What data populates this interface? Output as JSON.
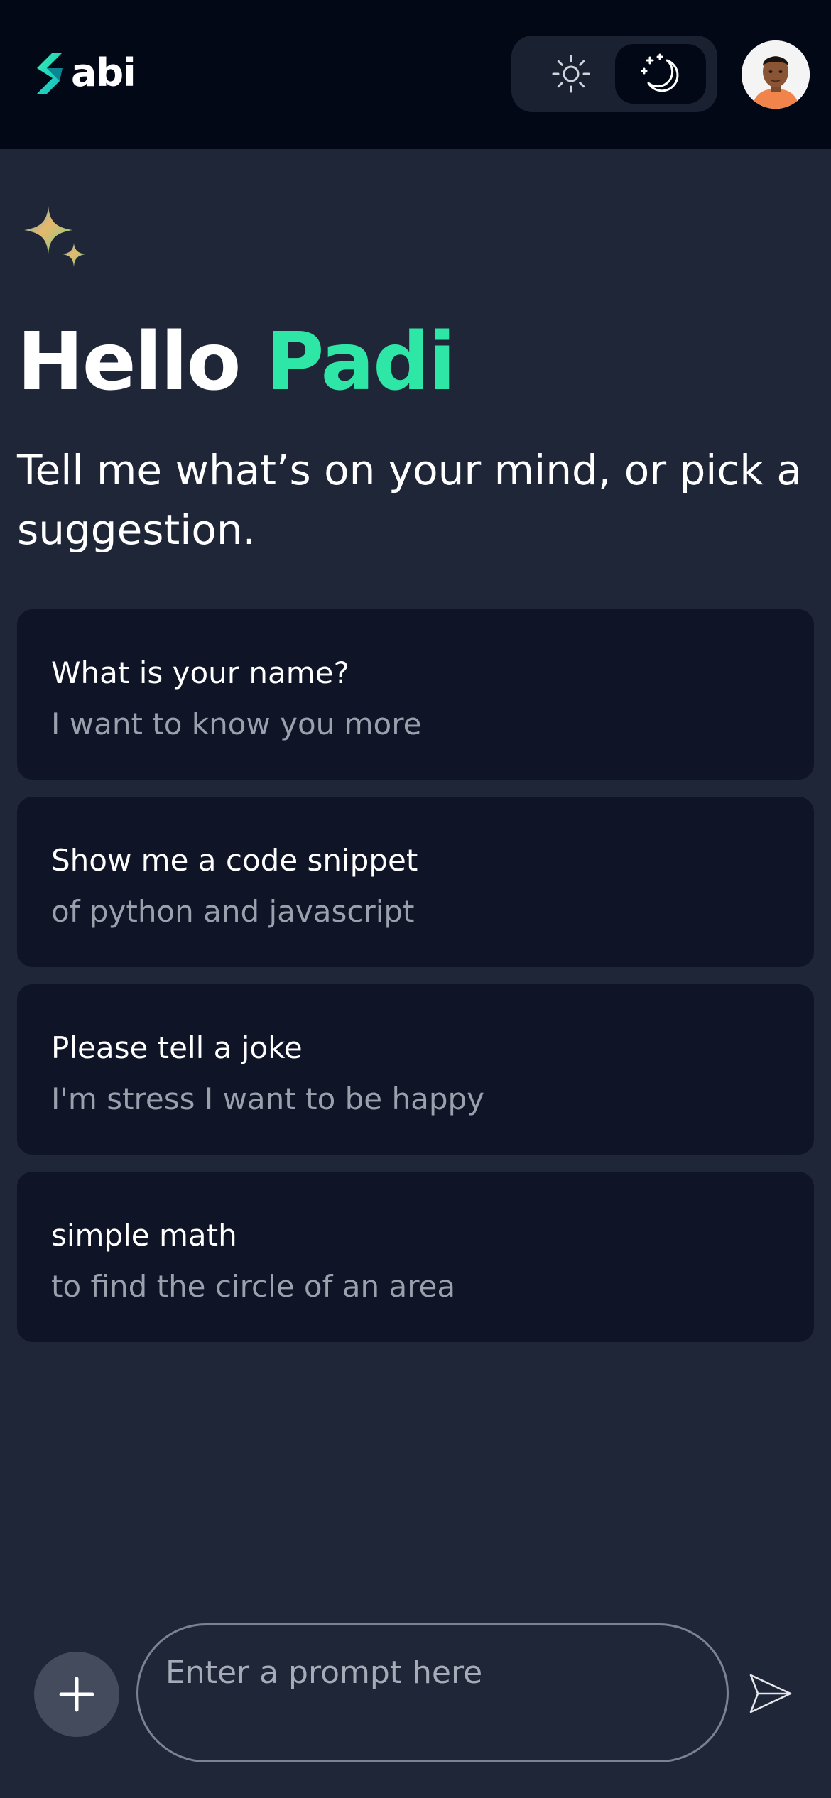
{
  "header": {
    "logo_text": "abi",
    "theme": {
      "light_icon": "sun-icon",
      "dark_icon": "moon-stars-icon",
      "active": "dark"
    },
    "avatar_icon": "user-avatar"
  },
  "greeting": {
    "hello": "Hello",
    "name": "Padi",
    "subtitle": "Tell me what’s on your mind, or pick a suggestion."
  },
  "suggestions": [
    {
      "title": "What is your name?",
      "subtitle": "I want to know you more"
    },
    {
      "title": "Show me a code snippet",
      "subtitle": "of python and javascript"
    },
    {
      "title": "Please tell a joke",
      "subtitle": "I'm stress I want to be happy"
    },
    {
      "title": "simple math",
      "subtitle": "to find the circle of an area"
    }
  ],
  "prompt": {
    "placeholder": "Enter a prompt here",
    "add_icon": "plus-icon",
    "send_icon": "send-icon"
  },
  "colors": {
    "background": "#1e2638",
    "header": "#030816",
    "card": "#0f1526",
    "accent": "#2ee6a6",
    "muted_text": "#9aa1ad"
  }
}
